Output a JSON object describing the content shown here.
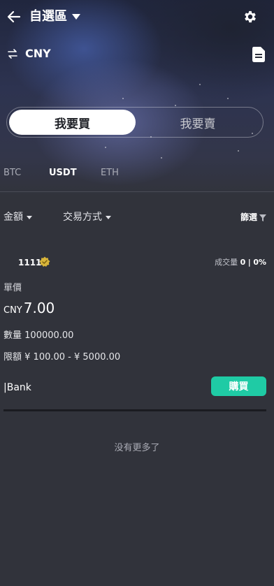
{
  "header": {
    "title": "自選區",
    "currency": "CNY"
  },
  "trade_toggle": {
    "buy_label": "我要買",
    "sell_label": "我要賣",
    "selected": "buy"
  },
  "coin_tabs": [
    {
      "label": "BTC",
      "active": false
    },
    {
      "label": "USDT",
      "active": true
    },
    {
      "label": "ETH",
      "active": false
    }
  ],
  "filters": {
    "amount_label": "金額",
    "payment_label": "交易方式",
    "screen_label": "篩選"
  },
  "listing": {
    "merchant": "1111",
    "volume_label": "成交量",
    "volume_value": "0",
    "volume_separator": "|",
    "volume_rate": "0%",
    "unit_price_label": "單價",
    "price_currency": "CNY",
    "price_value": "7.00",
    "quantity_label": "數量",
    "quantity_value": "100000.00",
    "limit_label": "限額",
    "limit_value": "¥ 100.00 - ¥ 5000.00",
    "payment_method": "|Bank",
    "buy_button": "購買"
  },
  "footer": {
    "no_more": "没有更多了"
  },
  "colors": {
    "accent": "#1fcba5",
    "background": "#31333b"
  },
  "icons": [
    "back-arrow-icon",
    "caret-down-icon",
    "gear-icon",
    "swap-icon",
    "document-icon",
    "funnel-icon",
    "verified-badge-icon"
  ]
}
